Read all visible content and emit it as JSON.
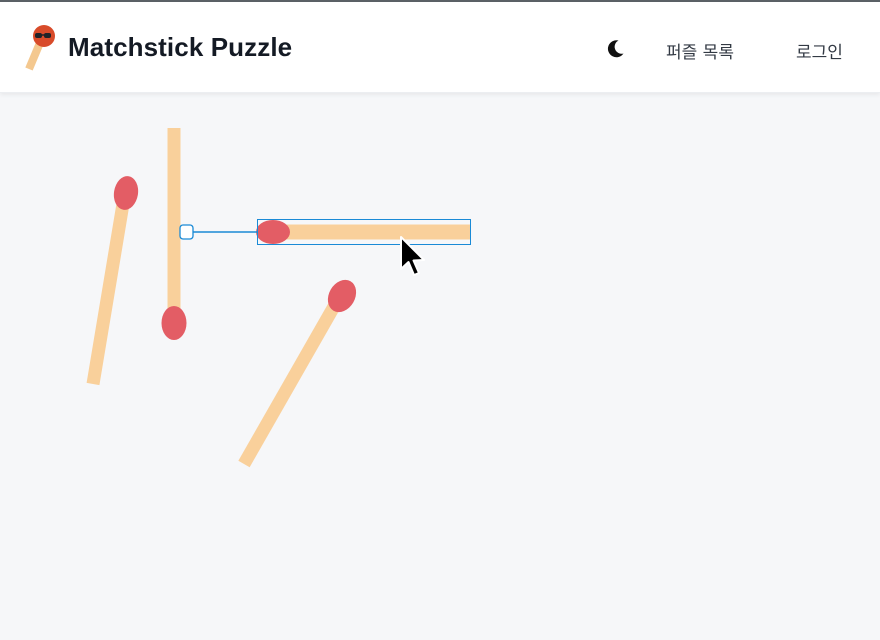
{
  "app": {
    "brand": "Matchstick Puzzle",
    "logo_icon": "matchstick-logo-icon",
    "theme_icon": "moon-icon"
  },
  "nav": {
    "puzzles_label": "퍼즐 목록",
    "login_label": "로그인"
  },
  "colors": {
    "header_bg": "#ffffff",
    "canvas_bg": "#f6f7f9",
    "match_stick": "#f9d09b",
    "match_head": "#e35d65",
    "selection": "#1a8ad6",
    "logo_head": "#d84b2a",
    "logo_stick": "#f4c88f"
  },
  "canvas": {
    "matches": [
      {
        "id": "match-1",
        "selected": false
      },
      {
        "id": "match-2",
        "selected": false
      },
      {
        "id": "match-3",
        "selected": true
      },
      {
        "id": "match-4",
        "selected": false
      }
    ]
  }
}
